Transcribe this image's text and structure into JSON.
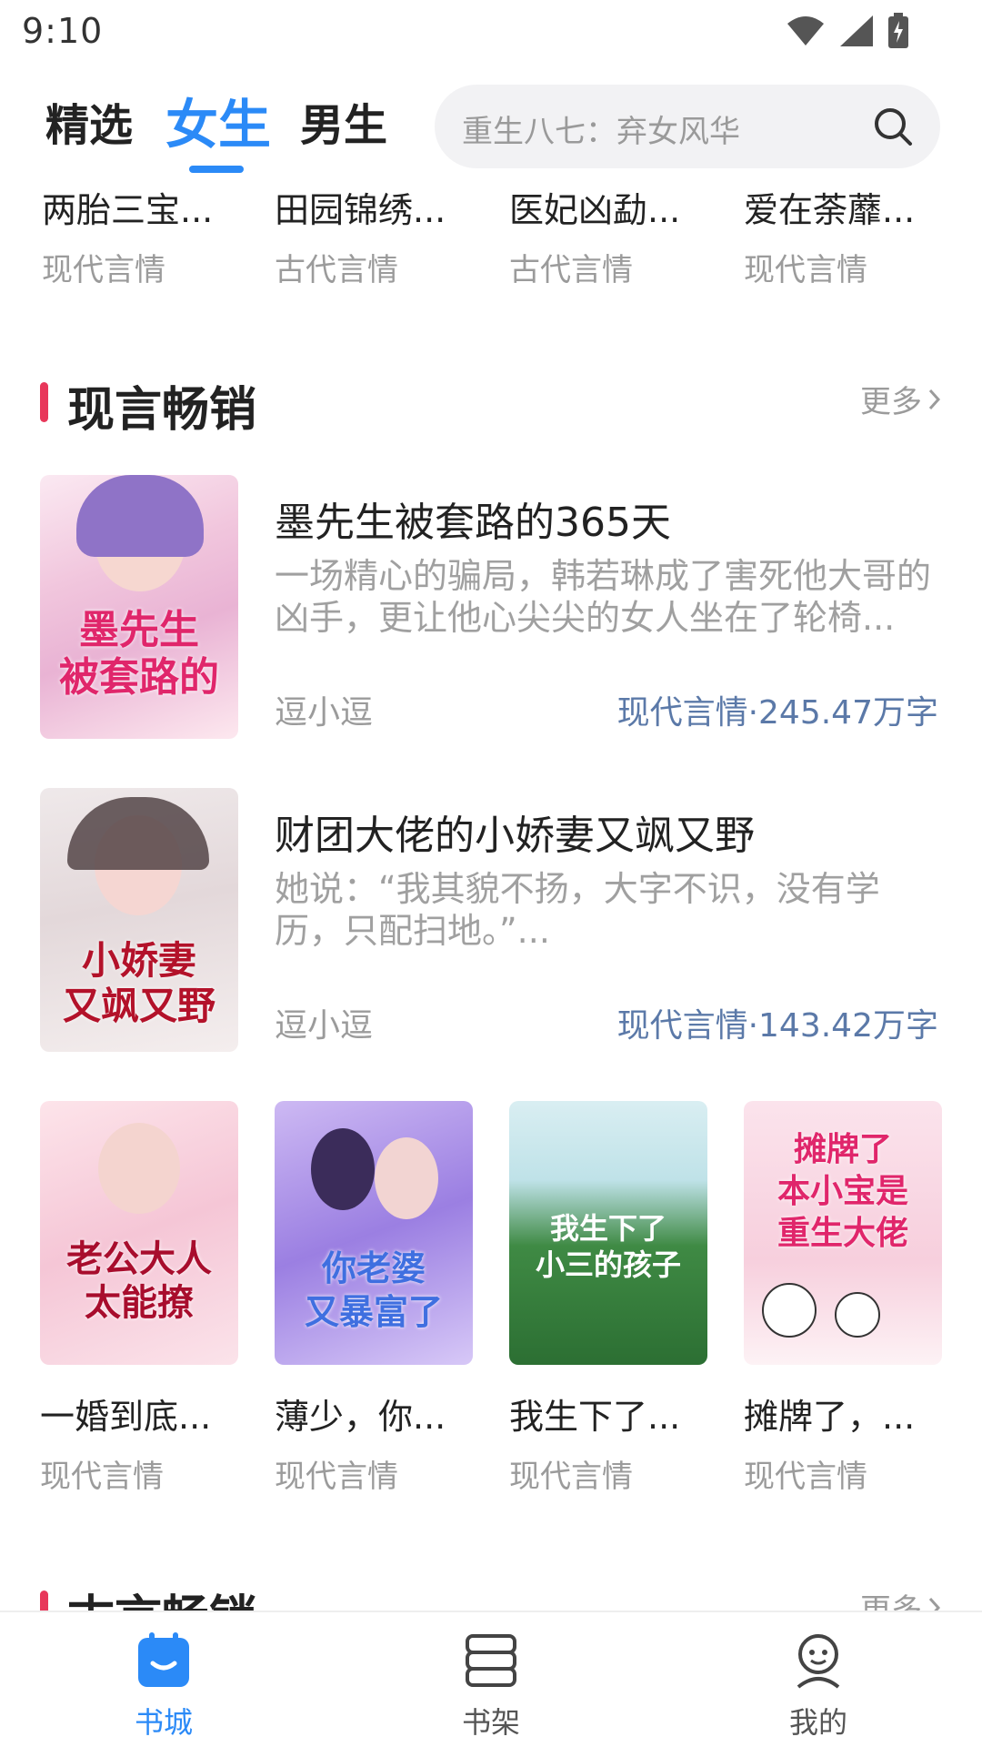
{
  "status_bar": {
    "time": "9:10"
  },
  "header": {
    "tabs": [
      {
        "label": "精选",
        "active": false
      },
      {
        "label": "女生",
        "active": true
      },
      {
        "label": "男生",
        "active": false
      }
    ],
    "search": {
      "placeholder": "重生八七：弃女风华"
    },
    "accent_color": "#2b8af7"
  },
  "top_grid": [
    {
      "title": "两胎三宝...",
      "tag": "现代言情"
    },
    {
      "title": "田园锦绣...",
      "tag": "古代言情"
    },
    {
      "title": "医妃凶勐...",
      "tag": "古代言情"
    },
    {
      "title": "爱在荼蘼...",
      "tag": "现代言情"
    }
  ],
  "section_modern": {
    "title": "现言畅销",
    "more_label": "更多",
    "list": [
      {
        "title": "墨先生被套路的365天",
        "desc": "一场精心的骗局，韩若琳成了害死他大哥的凶手，更让他心尖尖的女人坐在了轮椅...",
        "author": "逗小逗",
        "meta": "现代言情·245.47万字",
        "cover_text": "墨先生\n被套路的"
      },
      {
        "title": "财团大佬的小娇妻又飒又野",
        "desc": "她说：“我其貌不扬，大字不识，没有学历，只配扫地。”...",
        "author": "逗小逗",
        "meta": "现代言情·143.42万字",
        "cover_text": "小娇妻\n又飒又野"
      }
    ],
    "grid": [
      {
        "title": "一婚到底...",
        "tag": "现代言情",
        "cover_text": "老公大人\n太能撩"
      },
      {
        "title": "薄少，你...",
        "tag": "现代言情",
        "cover_text": "你老婆\n又暴富了"
      },
      {
        "title": "我生下了...",
        "tag": "现代言情",
        "cover_text": "我生下了\n小三的孩子"
      },
      {
        "title": "摊牌了，...",
        "tag": "现代言情",
        "cover_text": "摊牌了\n本小宝是\n重生大佬"
      }
    ]
  },
  "section_ancient": {
    "title": "古言畅销",
    "more_label": "更多"
  },
  "bottom_nav": {
    "items": [
      {
        "label": "书城",
        "icon": "bookstore-icon",
        "active": true
      },
      {
        "label": "书架",
        "icon": "bookshelf-icon",
        "active": false
      },
      {
        "label": "我的",
        "icon": "profile-icon",
        "active": false
      }
    ]
  }
}
